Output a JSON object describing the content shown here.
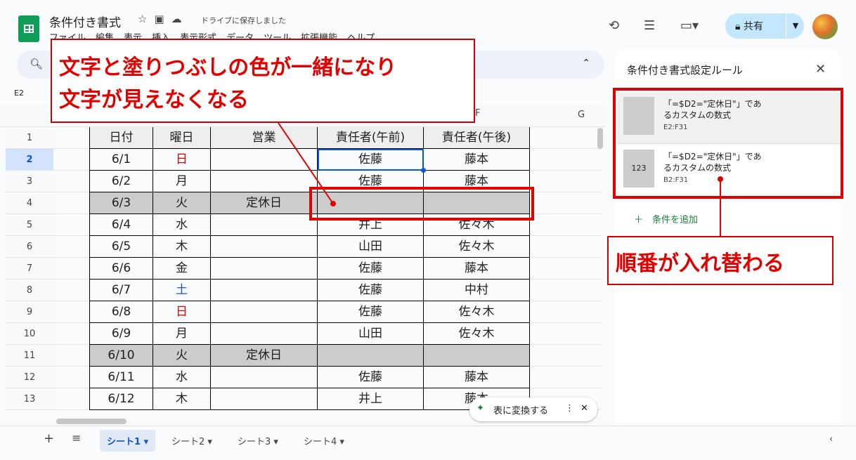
{
  "header": {
    "title": "条件付き書式",
    "saved_status": "ドライブに保存しました",
    "menu": [
      "ファイル",
      "編集",
      "表示",
      "挿入",
      "表示形式",
      "データ",
      "ツール",
      "拡張機能",
      "ヘルプ"
    ],
    "share_label": "共有"
  },
  "name_box": "E2",
  "columns": {
    "f": "F",
    "g": "G"
  },
  "table": {
    "headers": [
      "日付",
      "曜日",
      "営業",
      "責任者(午前)",
      "責任者(午後)"
    ],
    "rows": [
      {
        "num": "2",
        "date": "6/1",
        "day": "日",
        "open": "",
        "am": "佐藤",
        "pm": "藤本"
      },
      {
        "num": "3",
        "date": "6/2",
        "day": "月",
        "open": "",
        "am": "佐藤",
        "pm": "藤本"
      },
      {
        "num": "4",
        "date": "6/3",
        "day": "火",
        "open": "定休日",
        "am": "",
        "pm": ""
      },
      {
        "num": "5",
        "date": "6/4",
        "day": "水",
        "open": "",
        "am": "井上",
        "pm": "佐々木"
      },
      {
        "num": "6",
        "date": "6/5",
        "day": "木",
        "open": "",
        "am": "山田",
        "pm": "佐々木"
      },
      {
        "num": "7",
        "date": "6/6",
        "day": "金",
        "open": "",
        "am": "佐藤",
        "pm": "藤本"
      },
      {
        "num": "8",
        "date": "6/7",
        "day": "土",
        "open": "",
        "am": "佐藤",
        "pm": "中村"
      },
      {
        "num": "9",
        "date": "6/8",
        "day": "日",
        "open": "",
        "am": "佐藤",
        "pm": "佐々木"
      },
      {
        "num": "10",
        "date": "6/9",
        "day": "月",
        "open": "",
        "am": "山田",
        "pm": "佐々木"
      },
      {
        "num": "11",
        "date": "6/10",
        "day": "火",
        "open": "定休日",
        "am": "",
        "pm": ""
      },
      {
        "num": "12",
        "date": "6/11",
        "day": "水",
        "open": "",
        "am": "佐藤",
        "pm": "藤本"
      },
      {
        "num": "13",
        "date": "6/12",
        "day": "木",
        "open": "",
        "am": "井上",
        "pm": "藤本"
      }
    ],
    "header_row_num": "1"
  },
  "panel": {
    "title": "条件付き書式設定ルール",
    "rules": [
      {
        "formula": "「=$D2=\"定休日\"」であるカスタムの数式",
        "range": "E2:F31",
        "sample": ""
      },
      {
        "formula": "「=$D2=\"定休日\"」であるカスタムの数式",
        "range": "B2:F31",
        "sample": "123"
      }
    ],
    "add_label": "条件を追加"
  },
  "annotations": {
    "line1": "文字と塗りつぶしの色が一緒になり",
    "line2": "文字が見えなくなる",
    "note2": "順番が入れ替わる"
  },
  "convert_label": "表に変換する",
  "sheets": [
    "シート1",
    "シート2",
    "シート3",
    "シート4"
  ],
  "colors": {
    "accent": "#0b57d0",
    "holiday_fill": "#cccccc",
    "annotation": "#e00000"
  }
}
